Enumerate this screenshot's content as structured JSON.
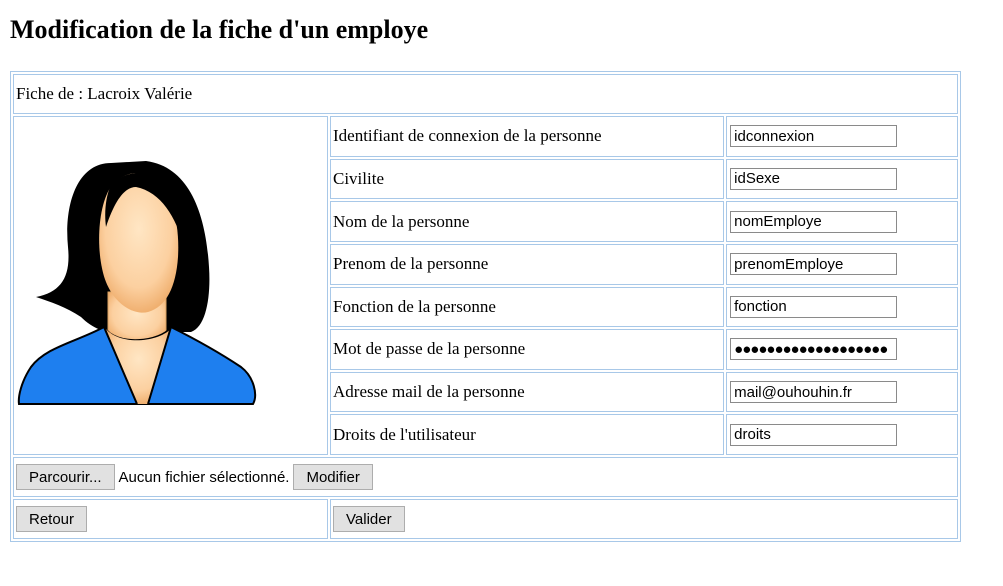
{
  "page": {
    "title": "Modification de la fiche d'un employe"
  },
  "fiche": {
    "header": "Fiche de : Lacroix Valérie",
    "rows": [
      {
        "label": "Identifiant de connexion de la personne",
        "value": "idconnexion",
        "type": "text"
      },
      {
        "label": "Civilite",
        "value": "idSexe",
        "type": "text"
      },
      {
        "label": "Nom de la personne",
        "value": "nomEmploye",
        "type": "text"
      },
      {
        "label": "Prenom de la personne",
        "value": "prenomEmploye",
        "type": "text"
      },
      {
        "label": "Fonction de la personne",
        "value": "fonction",
        "type": "text"
      },
      {
        "label": "Mot de passe de la personne",
        "value": "●●●●●●●●●●●●●●●●●●●",
        "type": "password"
      },
      {
        "label": "Adresse mail de la personne",
        "value": "mail@ouhouhin.fr",
        "type": "text"
      },
      {
        "label": "Droits de l'utilisateur",
        "value": "droits",
        "type": "text"
      }
    ],
    "avatar_icon": "woman-avatar-icon"
  },
  "file": {
    "browse_label": "Parcourir...",
    "status": "Aucun fichier sélectionné.",
    "modify_label": "Modifier"
  },
  "actions": {
    "back_label": "Retour",
    "validate_label": "Valider"
  },
  "colors": {
    "border": "#a8c8e8",
    "button_bg": "#e1e1e1",
    "avatar_shirt": "#1e7fef",
    "avatar_hair": "#000000",
    "avatar_skin": "#fcd0a0"
  }
}
